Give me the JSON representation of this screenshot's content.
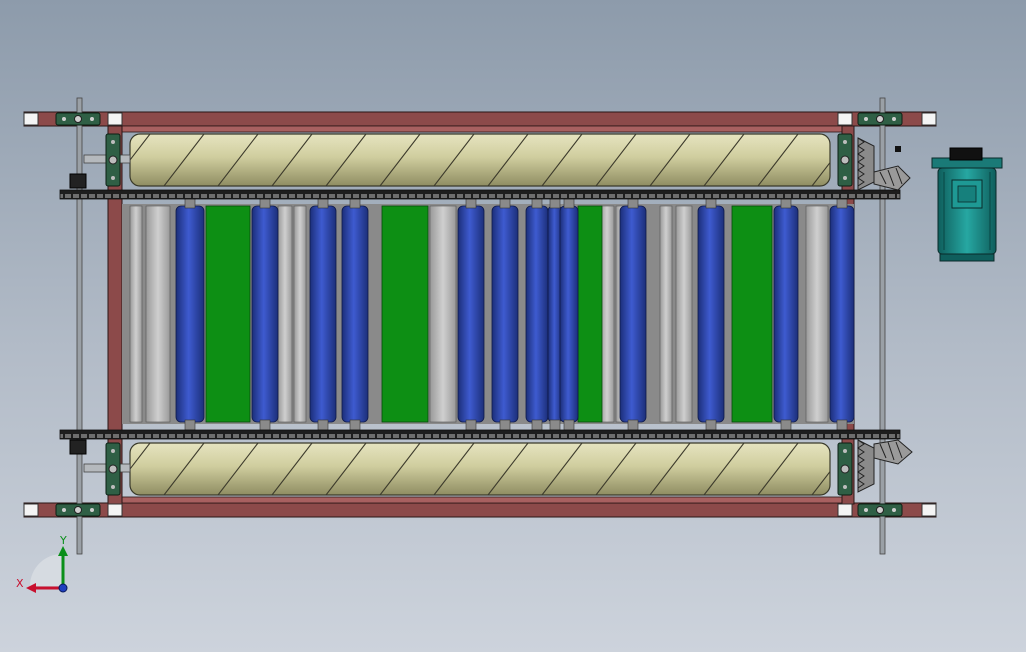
{
  "viewport": {
    "background_top": "#8d9bab",
    "background_bottom": "#cdd3dc"
  },
  "colors": {
    "frame_fill": "#8c4a4a",
    "frame_inner": "#b86a6a",
    "shaft": "#9aa0a6",
    "chain": "#2a2a2a",
    "drum_fill": "#c9c79a",
    "drum_stripe": "#4a4a3a",
    "roller_blue": "#2f4bb0",
    "roller_blue_dark": "#1c2f7a",
    "belt_green": "#0d8f14",
    "slat_grey": "#b4b4b4",
    "bearing_green": "#2f5f45",
    "motor_teal": "#1a8a86",
    "axis_x": "#c8102e",
    "axis_y": "#0a8f1a",
    "axis_z": "#1f3fbf"
  },
  "icons": {
    "motor": "motor-icon",
    "bevel_gear": "bevel-gear-icon",
    "bearing": "bearing-block-icon",
    "triad": "coordinate-triad-icon"
  },
  "triad": {
    "x_label": "X",
    "y_label": "Y"
  }
}
